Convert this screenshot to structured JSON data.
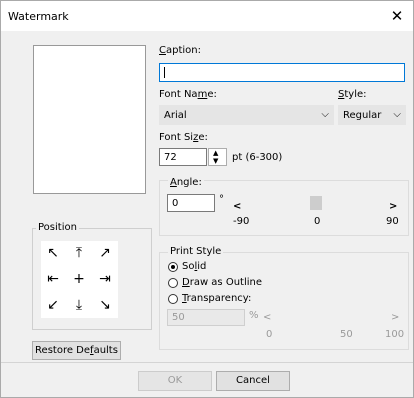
{
  "window": {
    "title": "Watermark",
    "close_icon": "close-icon"
  },
  "caption": {
    "label": "Caption:",
    "value": ""
  },
  "font_name": {
    "label": "Font Name:",
    "value": "Arial"
  },
  "style": {
    "label": "Style:",
    "value": "Regular"
  },
  "font_size": {
    "label": "Font Size:",
    "value": "72",
    "hint": "pt (6-300)"
  },
  "angle": {
    "label": "Angle:",
    "value": "0",
    "degree": "°",
    "left_arrow": "<",
    "right_arrow": ">",
    "min": "-90",
    "mid": "0",
    "max": "90",
    "level": 0
  },
  "position": {
    "label": "Position",
    "arrows": [
      "↖",
      "⤒",
      "↗",
      "⇤",
      "+",
      "⇥",
      "↙",
      "⤓",
      "↘"
    ]
  },
  "print_style": {
    "label": "Print Style",
    "options": [
      "Solid",
      "Draw as Outline",
      "Transparency:"
    ],
    "selected": "Solid",
    "transparency_value": "50",
    "percent": "%",
    "left_arrow": "<",
    "right_arrow": ">",
    "min": "0",
    "mid": "50",
    "max": "100"
  },
  "buttons": {
    "restore": "Restore Defaults",
    "ok": "OK",
    "cancel": "Cancel"
  }
}
